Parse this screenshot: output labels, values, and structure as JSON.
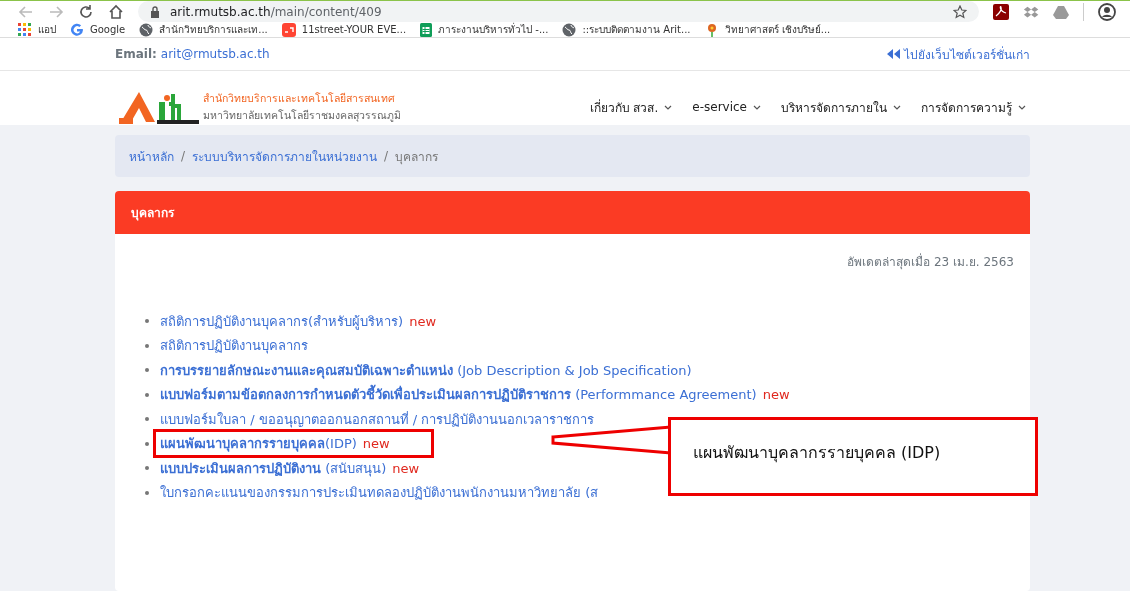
{
  "browser": {
    "url_host": "arit.rmutsb.ac.th",
    "url_path": "/main/content/409",
    "bookmarks": [
      {
        "label": "แอป",
        "kind": "apps"
      },
      {
        "label": "Google",
        "kind": "google"
      },
      {
        "label": "สำนักวิทยบริการและเท...",
        "kind": "globe"
      },
      {
        "label": "11street-YOUR EVE...",
        "kind": "store"
      },
      {
        "label": "ภาระงานบริหารทั่วไป -...",
        "kind": "sheet"
      },
      {
        "label": "::ระบบติดตามงาน Arit...",
        "kind": "globe"
      },
      {
        "label": "วิทยาศาสตร์ เชิงบริษย์...",
        "kind": "flower"
      }
    ]
  },
  "topbar": {
    "email_label": "Email:",
    "email": "arit@rmutsb.ac.th",
    "old_site": "ไปยังเว็บไซต์เวอร์ชั่นเก่า"
  },
  "header": {
    "logo_title": "สำนักวิทยบริการและเทคโนโลยีสารสนเทศ",
    "logo_subtitle": "มหาวิทยาลัยเทคโนโลยีราชมงคลสุวรรณภูมิ",
    "nav": [
      "เกี่ยวกับ สวส.",
      "e-service",
      "บริหารจัดการภายใน",
      "การจัดการความรู้"
    ]
  },
  "breadcrumb": [
    {
      "kind": "link",
      "text": "หน้าหลัก"
    },
    {
      "kind": "separator",
      "text": "/"
    },
    {
      "kind": "link",
      "text": "ระบบบริหารจัดการภายในหน่วยงาน"
    },
    {
      "kind": "separator",
      "text": "/"
    },
    {
      "kind": "current",
      "text": "บุคลากร"
    }
  ],
  "panel": {
    "title": "บุคลากร",
    "updated": "อัพเดตล่าสุดเมื่อ 23 เม.ย. 2563",
    "items": [
      {
        "text": "สถิติการปฏิบัติงานบุคลากร(สำหรับผู้บริหาร)",
        "badge": "new",
        "highlighted": false
      },
      {
        "text": "สถิติการปฏิบัติงานบุคลากร",
        "highlighted": false
      },
      {
        "text": "**การบรรยายลักษณะงานและคุณสมบัติเฉพาะตำแหน่ง** (Job Description & Job Specification)",
        "highlighted": false
      },
      {
        "text": "**แบบฟอร์มตามข้อตกลงการกำหนดตัวชี้วัดเพื่อประเมินผลการปฏิบัติราชการ** (Performmance Agreement)",
        "badge": "new",
        "highlighted": false
      },
      {
        "text": "แบบฟอร์มใบลา / ขออนุญาตออกนอกสถานที่ / การปฏิบัติงานนอกเวลาราชการ",
        "highlighted": false
      },
      {
        "text": "**แผนพัฒนาบุคลากรรายบุคคล**(IDP)",
        "badge": "new",
        "highlighted": true
      },
      {
        "text": "**แบบประเมินผลการปฏิบัติงาน** (สนับสนุน)",
        "badge": "new",
        "highlighted": false
      },
      {
        "text": "ใบกรอกคะแนนของกรรมการประเมินทดลองปฏิบัติงานพนักงานมหาวิทยาลัย (ส",
        "highlighted": false
      }
    ]
  },
  "callout": {
    "text": "แผนพัฒนาบุคลากรรายบุคคล (IDP)"
  }
}
